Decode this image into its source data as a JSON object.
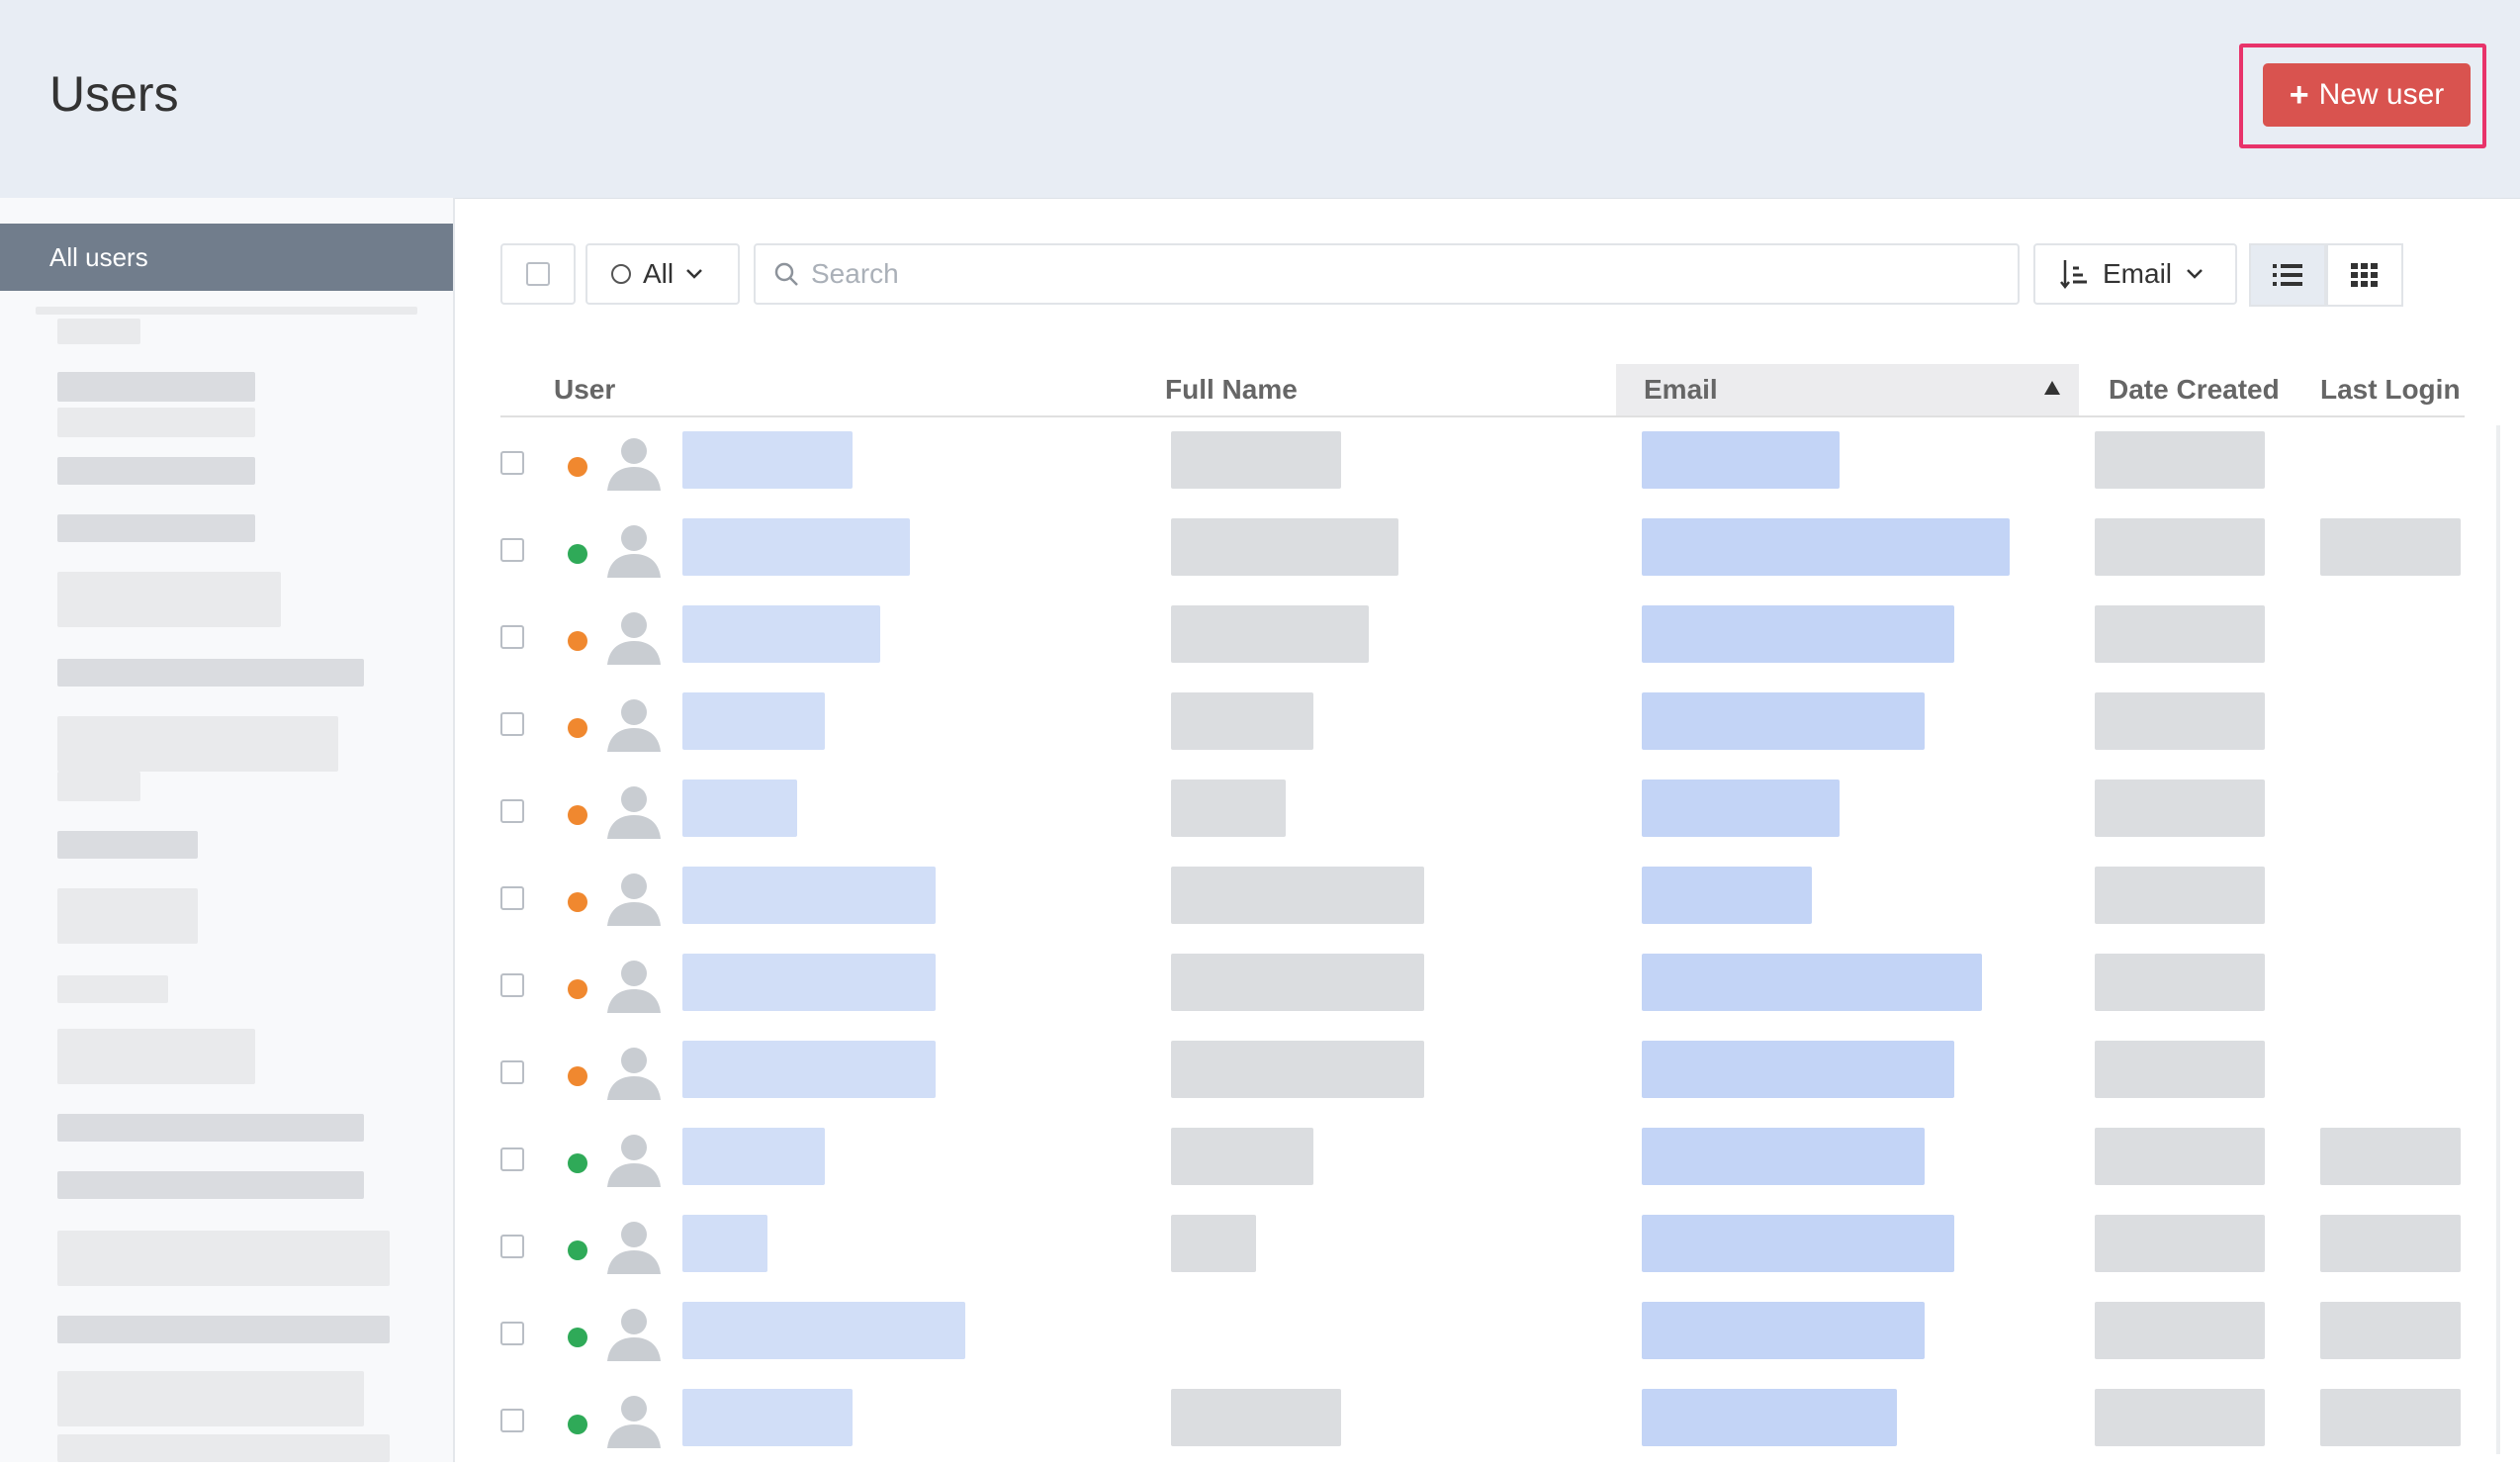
{
  "header": {
    "title": "Users",
    "new_user_label": "New user"
  },
  "sidebar": {
    "active_item": "All users"
  },
  "toolbar": {
    "filter_label": "All",
    "search_placeholder": "Search",
    "sort_label": "Email"
  },
  "columns": {
    "user": "User",
    "full_name": "Full Name",
    "email": "Email",
    "date_created": "Date Created",
    "last_login": "Last Login"
  },
  "rows": [
    {
      "status": "orange",
      "has_last_login": false,
      "has_full_name": true
    },
    {
      "status": "green",
      "has_last_login": true,
      "has_full_name": true
    },
    {
      "status": "orange",
      "has_last_login": false,
      "has_full_name": true
    },
    {
      "status": "orange",
      "has_last_login": false,
      "has_full_name": true
    },
    {
      "status": "orange",
      "has_last_login": false,
      "has_full_name": true
    },
    {
      "status": "orange",
      "has_last_login": false,
      "has_full_name": true
    },
    {
      "status": "orange",
      "has_last_login": false,
      "has_full_name": true
    },
    {
      "status": "orange",
      "has_last_login": false,
      "has_full_name": true
    },
    {
      "status": "green",
      "has_last_login": true,
      "has_full_name": true
    },
    {
      "status": "green",
      "has_last_login": true,
      "has_full_name": true
    },
    {
      "status": "green",
      "has_last_login": true,
      "has_full_name": false
    },
    {
      "status": "green",
      "has_last_login": true,
      "has_full_name": true
    }
  ],
  "colors": {
    "accent_button": "#d9534f",
    "highlight_border": "#e8336a",
    "status_orange": "#f0882f",
    "status_green": "#2faa58"
  }
}
